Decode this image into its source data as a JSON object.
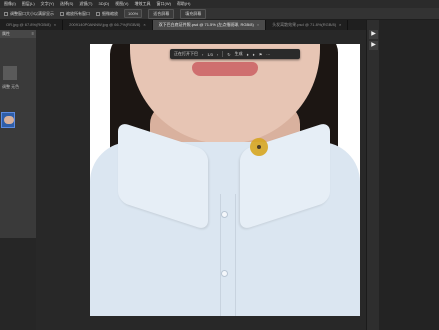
{
  "menubar": {
    "items": [
      "图像(I)",
      "图层(L)",
      "文字(Y)",
      "选择(S)",
      "滤镜(T)",
      "3D(D)",
      "视图(V)",
      "增效工具",
      "窗口(W)",
      "帮助(H)"
    ]
  },
  "options": {
    "resize_windows": "调整窗口大小以满屏显示",
    "zoom_all": "缩放所有窗口",
    "scrubby_zoom": "细微缩放",
    "zoom_value": "100%",
    "fit_screen": "适合屏幕",
    "fill_screen": "填充屏幕"
  },
  "tabs": [
    {
      "label": "OR.jpg @ 67.8%(RGB/8)",
      "active": false
    },
    {
      "label": "2009140P0ANNW.jpg @ 66.7%(RGB/8)",
      "active": false
    },
    {
      "label": "双下巴白底证件照.psd @ 71.5% (左点指斑球, RGB/8)",
      "active": true
    },
    {
      "label": "头发离散效果.psd @ 71.8%(RGB/8)",
      "active": false
    }
  ],
  "left_panel": {
    "header": "属性",
    "preview_label": "调整 无色"
  },
  "floating_bar": {
    "text": "正在打开下巴",
    "page": "1/3",
    "action": "生成"
  },
  "right_strip": {
    "buttons": [
      "▶",
      "▶"
    ]
  }
}
